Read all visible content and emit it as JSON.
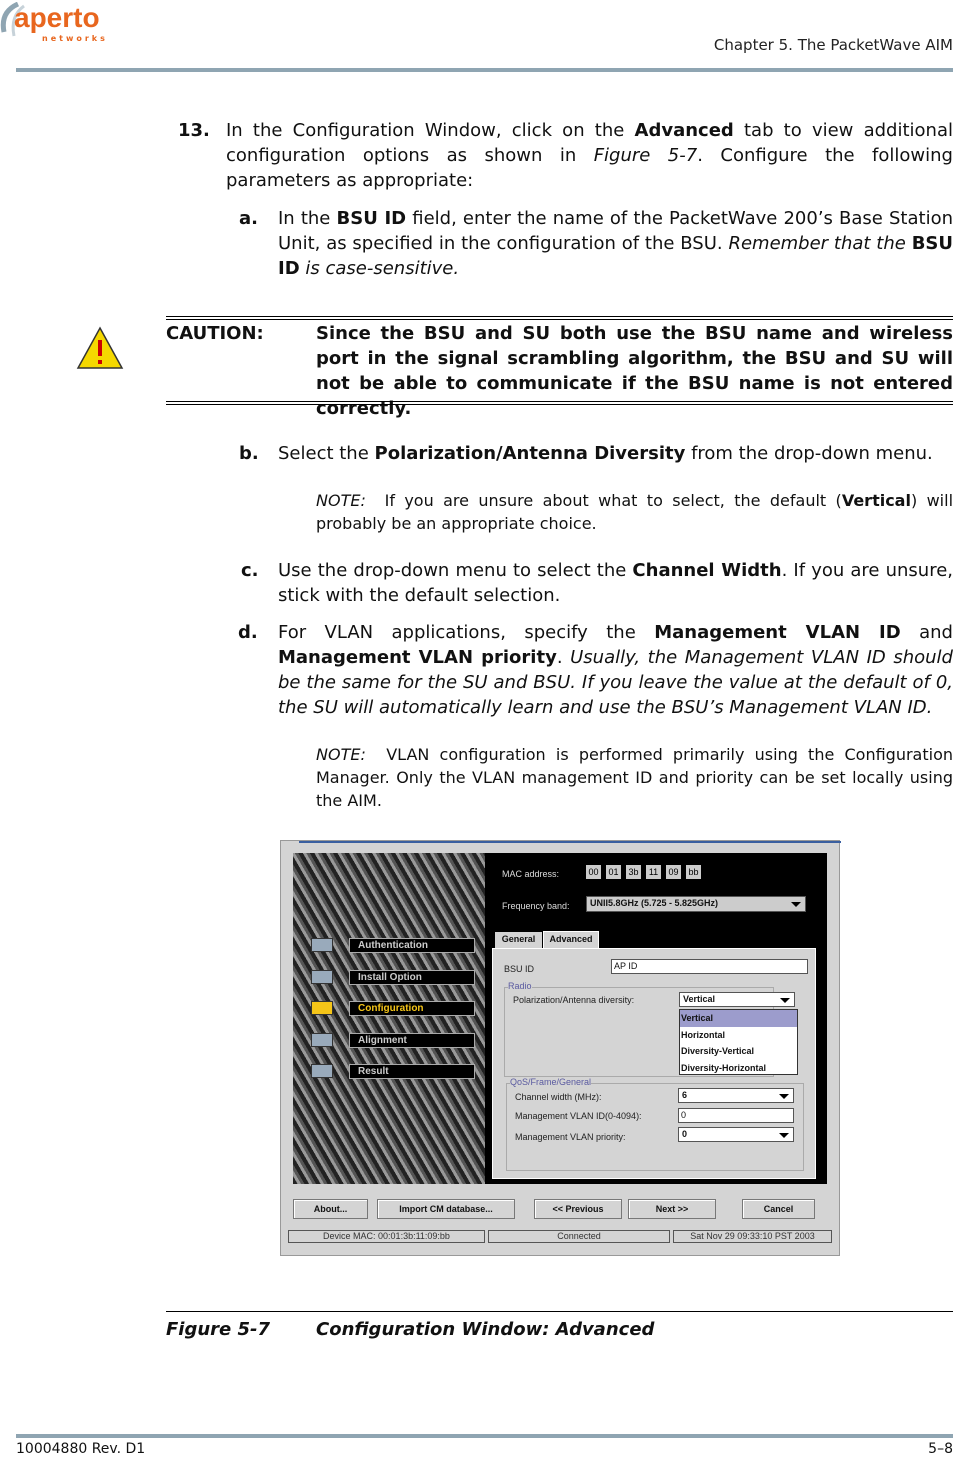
{
  "header": {
    "logo_text": "aperto",
    "logo_subtext": "networks",
    "chapter": "Chapter 5.  The PacketWave AIM"
  },
  "step13": {
    "number": "13.",
    "text_html": "In the Configuration Window, click on the <b>Advanced</b> tab to view additional configuration options as shown in <i>Figure 5-7</i>. Configure the following parameters as appropriate:"
  },
  "stepA": {
    "letter": "a.",
    "text_html": "In the <b>BSU ID</b> field, enter the name of the PacketWave 200’s Base Station Unit, as specified in the configuration of the BSU. <i>Remember that the</i> <b>BSU ID</b> <i>is case-sensitive.</i>"
  },
  "caution": {
    "label": "CAUTION:",
    "text": "Since the BSU and SU both use the BSU name and wireless port in the signal scrambling algorithm, the BSU and SU will not be able to communicate if the BSU name is not entered correctly."
  },
  "stepB": {
    "letter": "b.",
    "text_html": "Select the <b>Polarization/Antenna Diversity</b> from the drop-down menu.",
    "note_html": "<i>NOTE:</i>&nbsp; If you are unsure about what to select, the default (<b>Vertical</b>) will probably be an appropriate choice."
  },
  "stepC": {
    "letter": "c.",
    "text_html": "Use the drop-down menu to select the <b>Channel Width</b>. If you are unsure, stick with the default selection."
  },
  "stepD": {
    "letter": "d.",
    "text_html": "For VLAN applications, specify the <b>Management VLAN ID</b> and <b>Management VLAN priority</b>. <i>Usually, the Management VLAN ID should be the same for the SU and BSU. If you leave the value at the default of 0, the SU will automatically learn and use the BSU’s Management VLAN ID.</i>",
    "note_html": "<i>NOTE:</i>&nbsp; VLAN configuration is performed primarily using the Configuration Manager. Only the VLAN management ID and priority can be set locally using the AIM."
  },
  "screenshot": {
    "nav": [
      {
        "label": "Authentication",
        "active": false
      },
      {
        "label": "Install Option",
        "active": false
      },
      {
        "label": "Configuration",
        "active": true
      },
      {
        "label": "Alignment",
        "active": false
      },
      {
        "label": "Result",
        "active": false
      }
    ],
    "mac_label": "MAC address:",
    "mac": [
      "00",
      "01",
      "3b",
      "11",
      "09",
      "bb"
    ],
    "freq_label": "Frequency band:",
    "freq_value": "UNII5.8GHz (5.725 - 5.825GHz)",
    "tabs": [
      "General",
      "Advanced"
    ],
    "active_tab": "Advanced",
    "bsu_label": "BSU ID",
    "bsu_value": "AP ID",
    "radio_group": "Radio",
    "pol_label": "Polarization/Antenna diversity:",
    "pol_value": "Vertical",
    "pol_options": [
      "Vertical",
      "Horizontal",
      "Diversity-Vertical",
      "Diversity-Horizontal"
    ],
    "qos_group": "QoS/Frame/General",
    "cw_label": "Channel width (MHz):",
    "cw_value": "6",
    "vid_label": "Management VLAN ID(0-4094):",
    "vid_value": "0",
    "vpri_label": "Management VLAN priority:",
    "vpri_value": "0",
    "buttons": {
      "about": "About...",
      "import": "Import CM database...",
      "prev": "<< Previous",
      "next": "Next >>",
      "cancel": "Cancel"
    },
    "status": {
      "device": "Device MAC: 00:01:3b:11:09:bb",
      "conn": "Connected",
      "time": "Sat Nov 29 09:33:10 PST 2003"
    },
    "accent": "#f5c518",
    "highlight": "#9c9ccc",
    "group_color": "#5a5aa0"
  },
  "figure": {
    "number": "Figure 5-7",
    "title": "Configuration Window: Advanced"
  },
  "footer": {
    "doc": "10004880 Rev. D1",
    "page": "5–8"
  }
}
